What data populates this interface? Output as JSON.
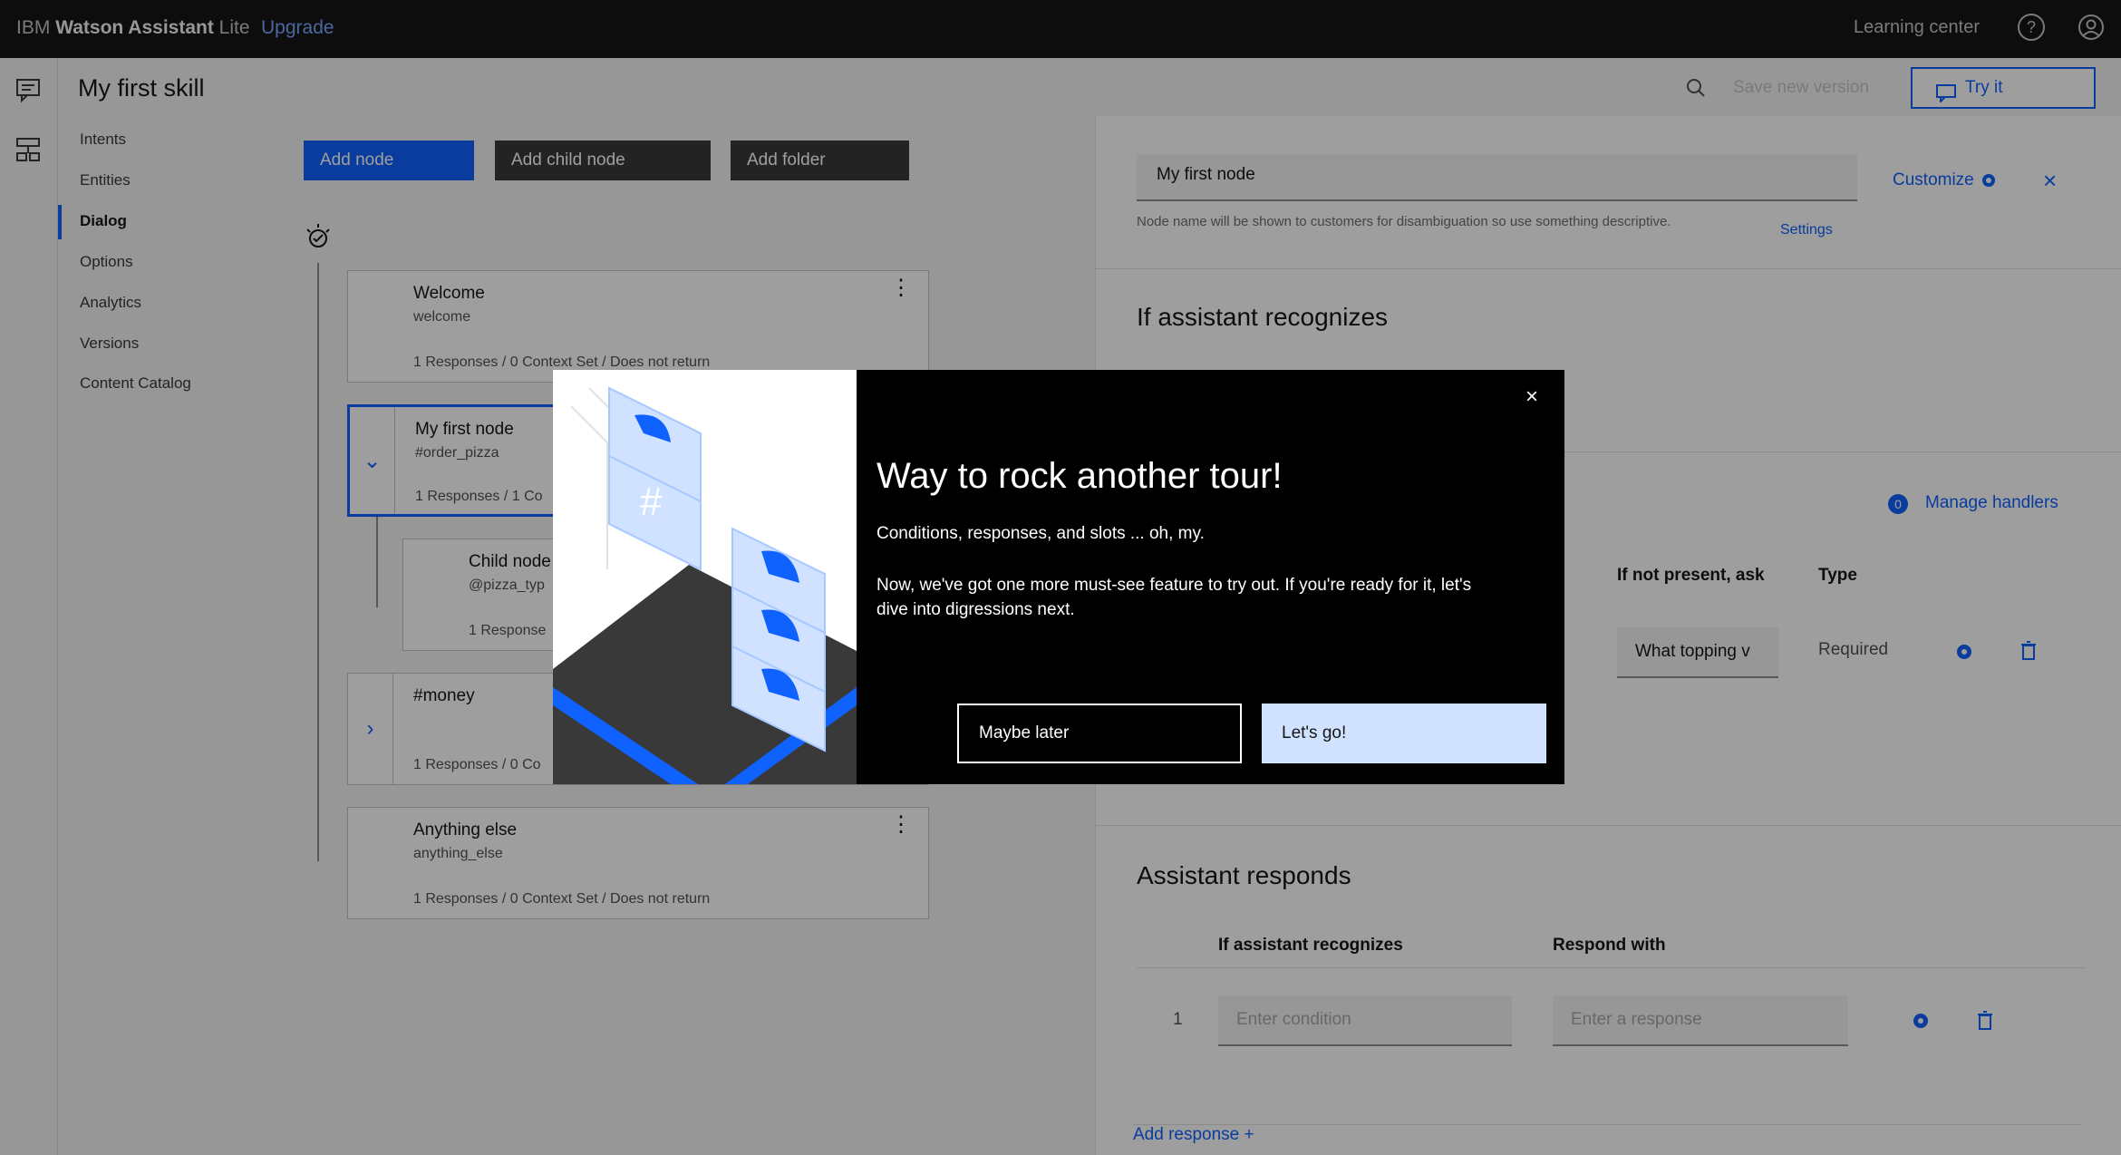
{
  "topbar": {
    "brand_prefix": "IBM",
    "brand_name": "Watson Assistant",
    "brand_plan": "Lite",
    "upgrade": "Upgrade",
    "learning_center": "Learning center"
  },
  "header": {
    "skill_title": "My first skill",
    "save_version": "Save new version",
    "try_it": "Try it"
  },
  "nav": {
    "items": [
      "Intents",
      "Entities",
      "Dialog",
      "Options",
      "Analytics",
      "Versions",
      "Content Catalog"
    ],
    "active": "Dialog"
  },
  "toolbar": {
    "add_node": "Add node",
    "add_child_node": "Add child node",
    "add_folder": "Add folder"
  },
  "tree": {
    "nodes": [
      {
        "title": "Welcome",
        "condition": "welcome",
        "meta": "1 Responses / 0 Context Set / Does not return"
      },
      {
        "title": "My first node",
        "condition": "#order_pizza",
        "meta": "1 Responses / 1 Co"
      },
      {
        "title": "Child node",
        "condition": "@pizza_typ",
        "meta": "1 Response"
      },
      {
        "title": "#money",
        "condition": "",
        "meta": "1 Responses / 0 Co"
      },
      {
        "title": "Anything else",
        "condition": "anything_else",
        "meta": "1 Responses / 0 Context Set / Does not return"
      }
    ]
  },
  "panel": {
    "node_name": "My first node",
    "customize": "Customize",
    "helper": "Node name will be shown to customers for disambiguation so use something descriptive.",
    "settings": "Settings",
    "if_recognizes_heading": "If assistant recognizes",
    "handlers_count": "0",
    "manage_handlers": "Manage handlers",
    "slots_col_ask": "If not present, ask",
    "slots_col_type": "Type",
    "slot_prompt": "What topping v",
    "slot_type": "Required",
    "responds_heading": "Assistant responds",
    "resp_col_recognizes": "If assistant recognizes",
    "resp_col_respond": "Respond with",
    "resp_row_index": "1",
    "condition_placeholder": "Enter condition",
    "response_placeholder": "Enter a response",
    "add_response": "Add response",
    "add_response_plus": "+"
  },
  "modal": {
    "title": "Way to rock another tour!",
    "p1": "Conditions, responses, and slots ... oh, my.",
    "p2": "Now, we've got one more must-see feature to try out. If you're ready for it, let's dive into digressions next.",
    "maybe_later": "Maybe later",
    "lets_go": "Let's go!",
    "close_glyph": "×"
  },
  "colors": {
    "accent": "#0f62fe",
    "topbar": "#161616",
    "modal_bg": "#000000",
    "primary_light": "#d0e2ff"
  },
  "icons": [
    "chat-icon",
    "dialog-tree-icon",
    "help-icon",
    "user-icon",
    "search-icon",
    "gear-icon",
    "trash-icon",
    "close-icon",
    "chevron-down-icon",
    "chevron-right-icon",
    "overflow-menu-icon",
    "bulb-icon"
  ]
}
